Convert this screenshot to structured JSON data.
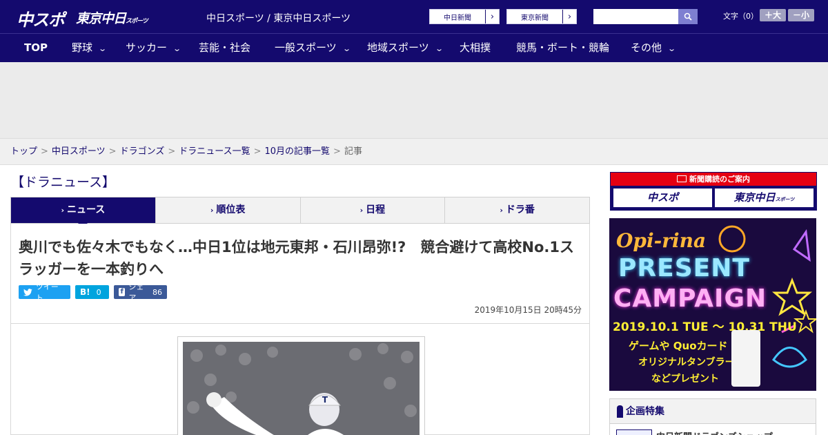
{
  "header": {
    "logo_chuspo": "中スポ",
    "logo_tokyo": "東京中日",
    "logo_tokyo_sub": "スポーツ",
    "site_title": "中日スポーツ / 東京中日スポーツ",
    "paper_links": [
      "中日新聞",
      "東京新聞"
    ],
    "search_placeholder": "",
    "fontsize_label": "文字（0）",
    "fontsize_up": "＋大",
    "fontsize_down": "－小"
  },
  "nav": {
    "items": [
      {
        "label": "TOP",
        "dropdown": false
      },
      {
        "label": "野球",
        "dropdown": true
      },
      {
        "label": "サッカー",
        "dropdown": true
      },
      {
        "label": "芸能・社会",
        "dropdown": false
      },
      {
        "label": "一般スポーツ",
        "dropdown": true
      },
      {
        "label": "地域スポーツ",
        "dropdown": true
      },
      {
        "label": "大相撲",
        "dropdown": false
      },
      {
        "label": "競馬・ボート・競輪",
        "dropdown": false
      },
      {
        "label": "その他",
        "dropdown": true
      }
    ]
  },
  "breadcrumb": {
    "items": [
      "トップ",
      "中日スポーツ",
      "ドラゴンズ",
      "ドラニュース一覧",
      "10月の記事一覧"
    ],
    "current": "記事",
    "separator": ">"
  },
  "section": {
    "title": "【ドラニュース】"
  },
  "tabs": [
    {
      "label": "ニュース",
      "active": true
    },
    {
      "label": "順位表",
      "active": false
    },
    {
      "label": "日程",
      "active": false
    },
    {
      "label": "ドラ番",
      "active": false
    }
  ],
  "article": {
    "headline": "奥川でも佐々木でもなく…中日1位は地元東邦・石川昂弥!?　競合避けて高校No.1スラッガーを一本釣りへ",
    "timestamp": "2019年10月15日 20時45分",
    "share": {
      "twitter_label": "ツイート",
      "hatena_label": "B!",
      "hatena_count": "0",
      "facebook_label": "シェア",
      "facebook_count": "86"
    }
  },
  "sidebar": {
    "subscribe_head": "新聞購読のご案内",
    "subscribe_logos": [
      "中スポ",
      "東京中日"
    ],
    "subscribe_logo_sub": "スポーツ",
    "campaign": {
      "brand": "Opi-rina",
      "line_a": "PRESENT",
      "line_b": "CAMPAIGN",
      "dates": "2019.10.1 TUE 〜 10.31 THU",
      "text1": "ゲームや Quoカード",
      "text2": "オリジナルタンブラー",
      "text3": "などプレゼント"
    },
    "feature_head": "企画特集",
    "feature_item": "中日新聞ドラゴンズショップ"
  },
  "colors": {
    "brand_navy": "#140a6e",
    "red": "#e50012",
    "twitter": "#1da1f2",
    "hatena": "#00a4de",
    "facebook": "#3b5998"
  }
}
